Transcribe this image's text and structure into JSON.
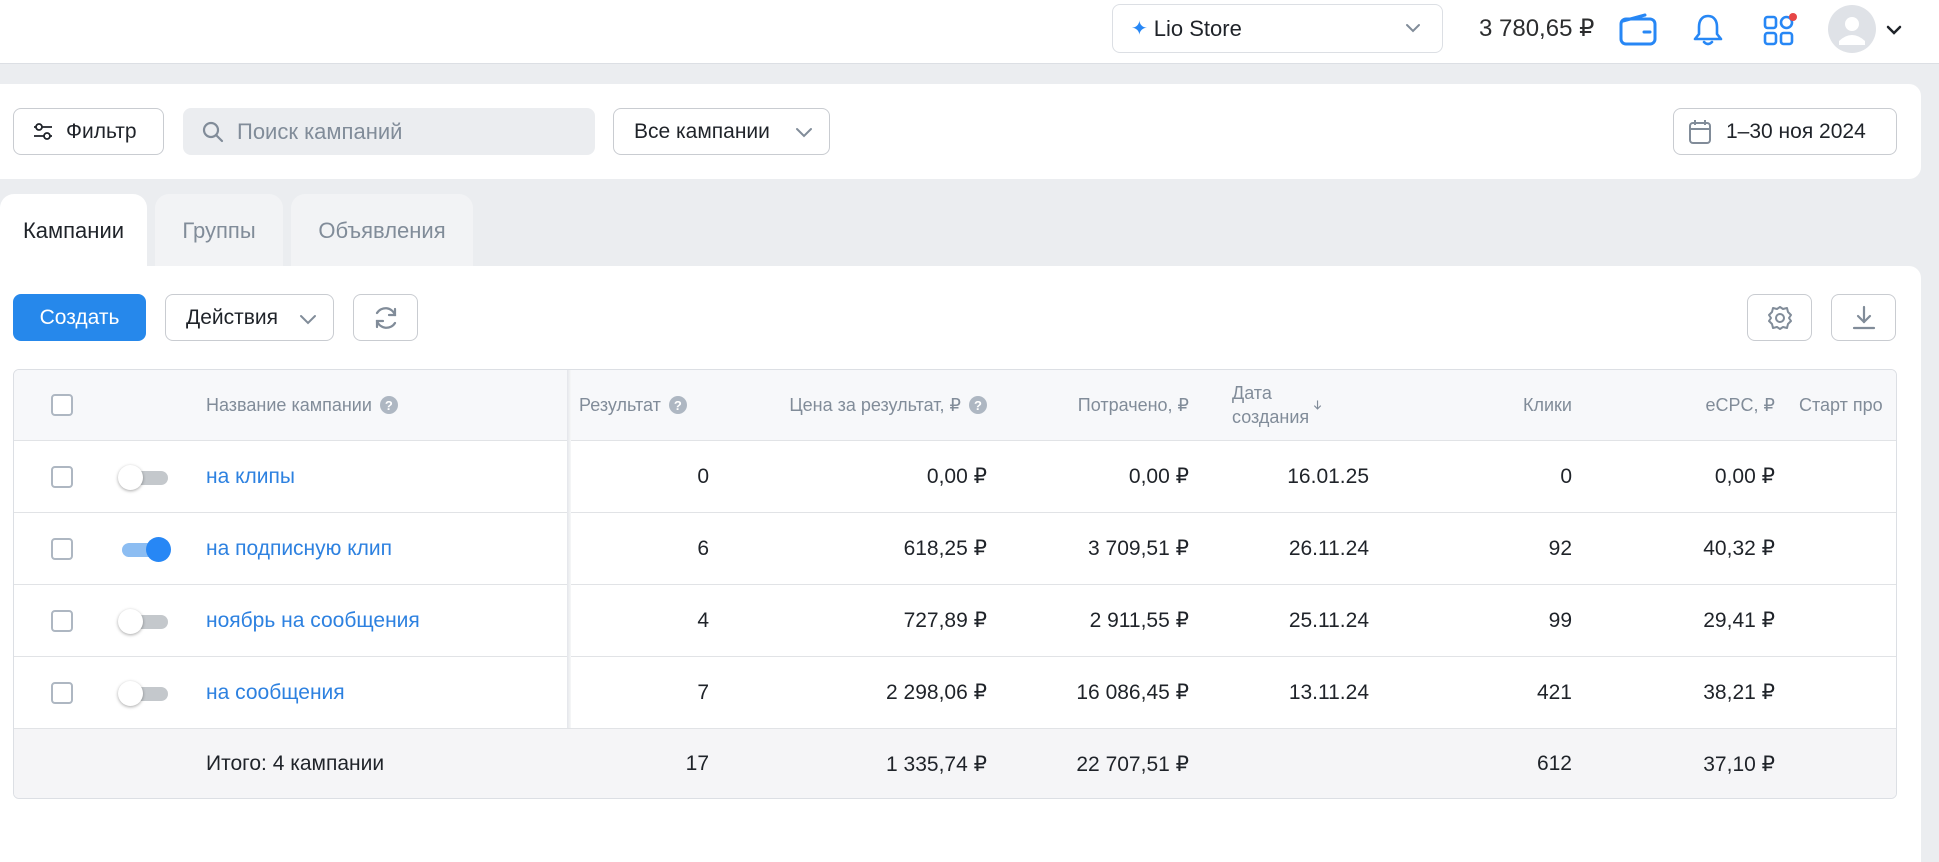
{
  "header": {
    "store_name": "Lio Store",
    "balance": "3 780,65 ₽",
    "icons": [
      "wallet-icon",
      "bell-icon",
      "apps-icon",
      "avatar-icon",
      "chevron-down-icon"
    ],
    "accent_color": "#2787f5",
    "notification_dot_color": "#e64646"
  },
  "filters": {
    "filter_label": "Фильтр",
    "search_placeholder": "Поиск кампаний",
    "campaigns_select": "Все кампании",
    "date_range": "1–30 ноя 2024"
  },
  "tabs": [
    {
      "label": "Кампании",
      "active": true
    },
    {
      "label": "Группы",
      "active": false
    },
    {
      "label": "Объявления",
      "active": false
    }
  ],
  "toolbar": {
    "create_label": "Создать",
    "actions_label": "Действия",
    "icons": [
      "refresh-icon",
      "settings-icon",
      "download-icon"
    ]
  },
  "table": {
    "columns": {
      "name": "Название кампании",
      "result": "Результат",
      "price": "Цена за результат, ₽",
      "spent": "Потрачено, ₽",
      "date_line1": "Дата",
      "date_line2": "создания",
      "clicks": "Клики",
      "ecpc": "eCPC, ₽",
      "start": "Старт про"
    },
    "rows": [
      {
        "name": "на клипы",
        "enabled": false,
        "result": "0",
        "price": "0,00 ₽",
        "spent": "0,00 ₽",
        "date": "16.01.25",
        "clicks": "0",
        "ecpc": "0,00 ₽"
      },
      {
        "name": "на подписную клип",
        "enabled": true,
        "result": "6",
        "price": "618,25 ₽",
        "spent": "3 709,51 ₽",
        "date": "26.11.24",
        "clicks": "92",
        "ecpc": "40,32 ₽"
      },
      {
        "name": "ноябрь на сообщения",
        "enabled": false,
        "result": "4",
        "price": "727,89 ₽",
        "spent": "2 911,55 ₽",
        "date": "25.11.24",
        "clicks": "99",
        "ecpc": "29,41 ₽"
      },
      {
        "name": "на сообщения",
        "enabled": false,
        "result": "7",
        "price": "2 298,06 ₽",
        "spent": "16 086,45 ₽",
        "date": "13.11.24",
        "clicks": "421",
        "ecpc": "38,21 ₽"
      }
    ],
    "totals": {
      "label": "Итого: 4 кампании",
      "result": "17",
      "price": "1 335,74 ₽",
      "spent": "22 707,51 ₽",
      "clicks": "612",
      "ecpc": "37,10 ₽"
    }
  }
}
